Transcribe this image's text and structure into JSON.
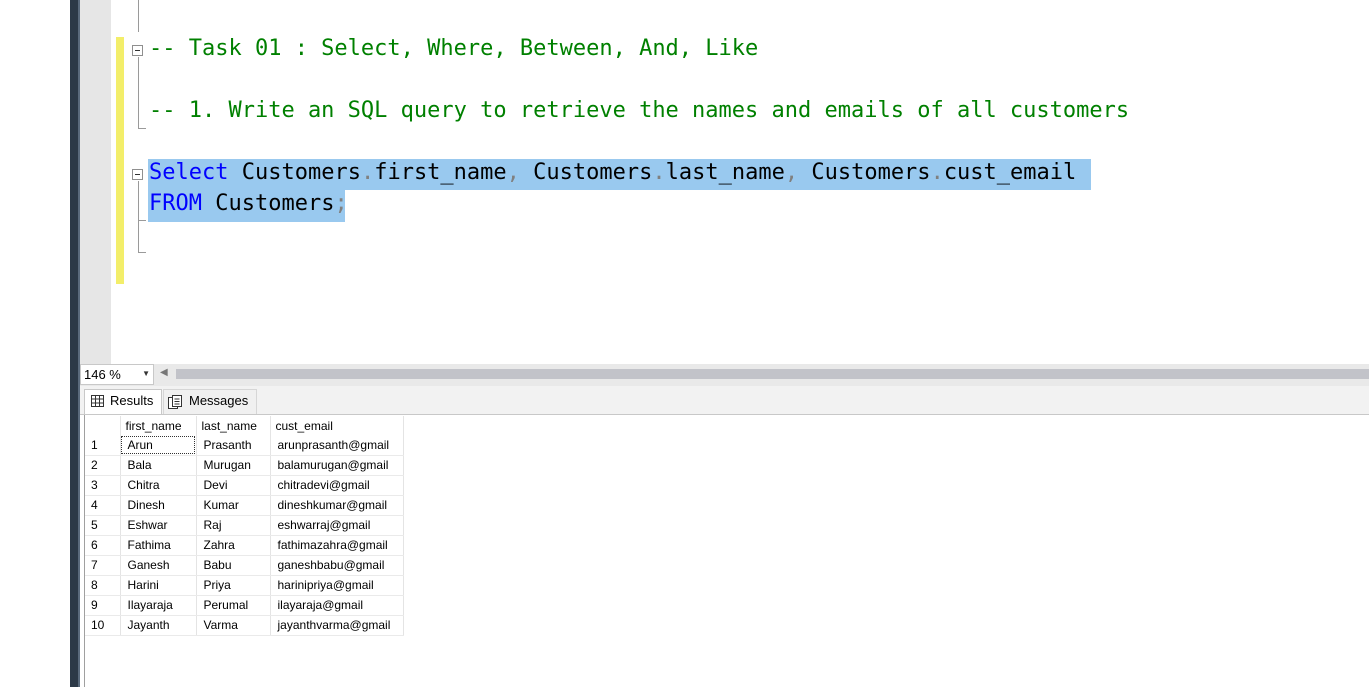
{
  "editor": {
    "line1": "-- Task 01 : Select, Where, Between, And, Like",
    "line2": "-- 1. Write an SQL query to retrieve the names and emails of all customers",
    "query": {
      "kw_select": "Select",
      "t1": "Customers",
      "c1": "first_name",
      "t2": "Customers",
      "c2": "last_name",
      "t3": "Customers",
      "c3": "cust_email",
      "kw_from": "FROM",
      "table": "Customers",
      "semicolon": ";"
    }
  },
  "zoom": {
    "value": "146 %"
  },
  "tabs": {
    "results": "Results",
    "messages": "Messages"
  },
  "grid": {
    "columns": [
      "first_name",
      "last_name",
      "cust_email"
    ],
    "rows": [
      {
        "n": "1",
        "first_name": "Arun",
        "last_name": "Prasanth",
        "cust_email": "arunprasanth@gmail"
      },
      {
        "n": "2",
        "first_name": "Bala",
        "last_name": "Murugan",
        "cust_email": "balamurugan@gmail"
      },
      {
        "n": "3",
        "first_name": "Chitra",
        "last_name": "Devi",
        "cust_email": "chitradevi@gmail"
      },
      {
        "n": "4",
        "first_name": "Dinesh",
        "last_name": "Kumar",
        "cust_email": "dineshkumar@gmail"
      },
      {
        "n": "5",
        "first_name": "Eshwar",
        "last_name": "Raj",
        "cust_email": "eshwarraj@gmail"
      },
      {
        "n": "6",
        "first_name": "Fathima",
        "last_name": "Zahra",
        "cust_email": "fathimazahra@gmail"
      },
      {
        "n": "7",
        "first_name": "Ganesh",
        "last_name": "Babu",
        "cust_email": "ganeshbabu@gmail"
      },
      {
        "n": "8",
        "first_name": "Harini",
        "last_name": "Priya",
        "cust_email": "harinipriya@gmail"
      },
      {
        "n": "9",
        "first_name": "Ilayaraja",
        "last_name": "Perumal",
        "cust_email": "ilayaraja@gmail"
      },
      {
        "n": "10",
        "first_name": "Jayanth",
        "last_name": "Varma",
        "cust_email": "jayanthvarma@gmail"
      }
    ]
  },
  "colors": {
    "comment": "#008000",
    "keyword": "#0000ff",
    "selection": "#99c9ef",
    "change_bar": "#f3ee6a"
  }
}
